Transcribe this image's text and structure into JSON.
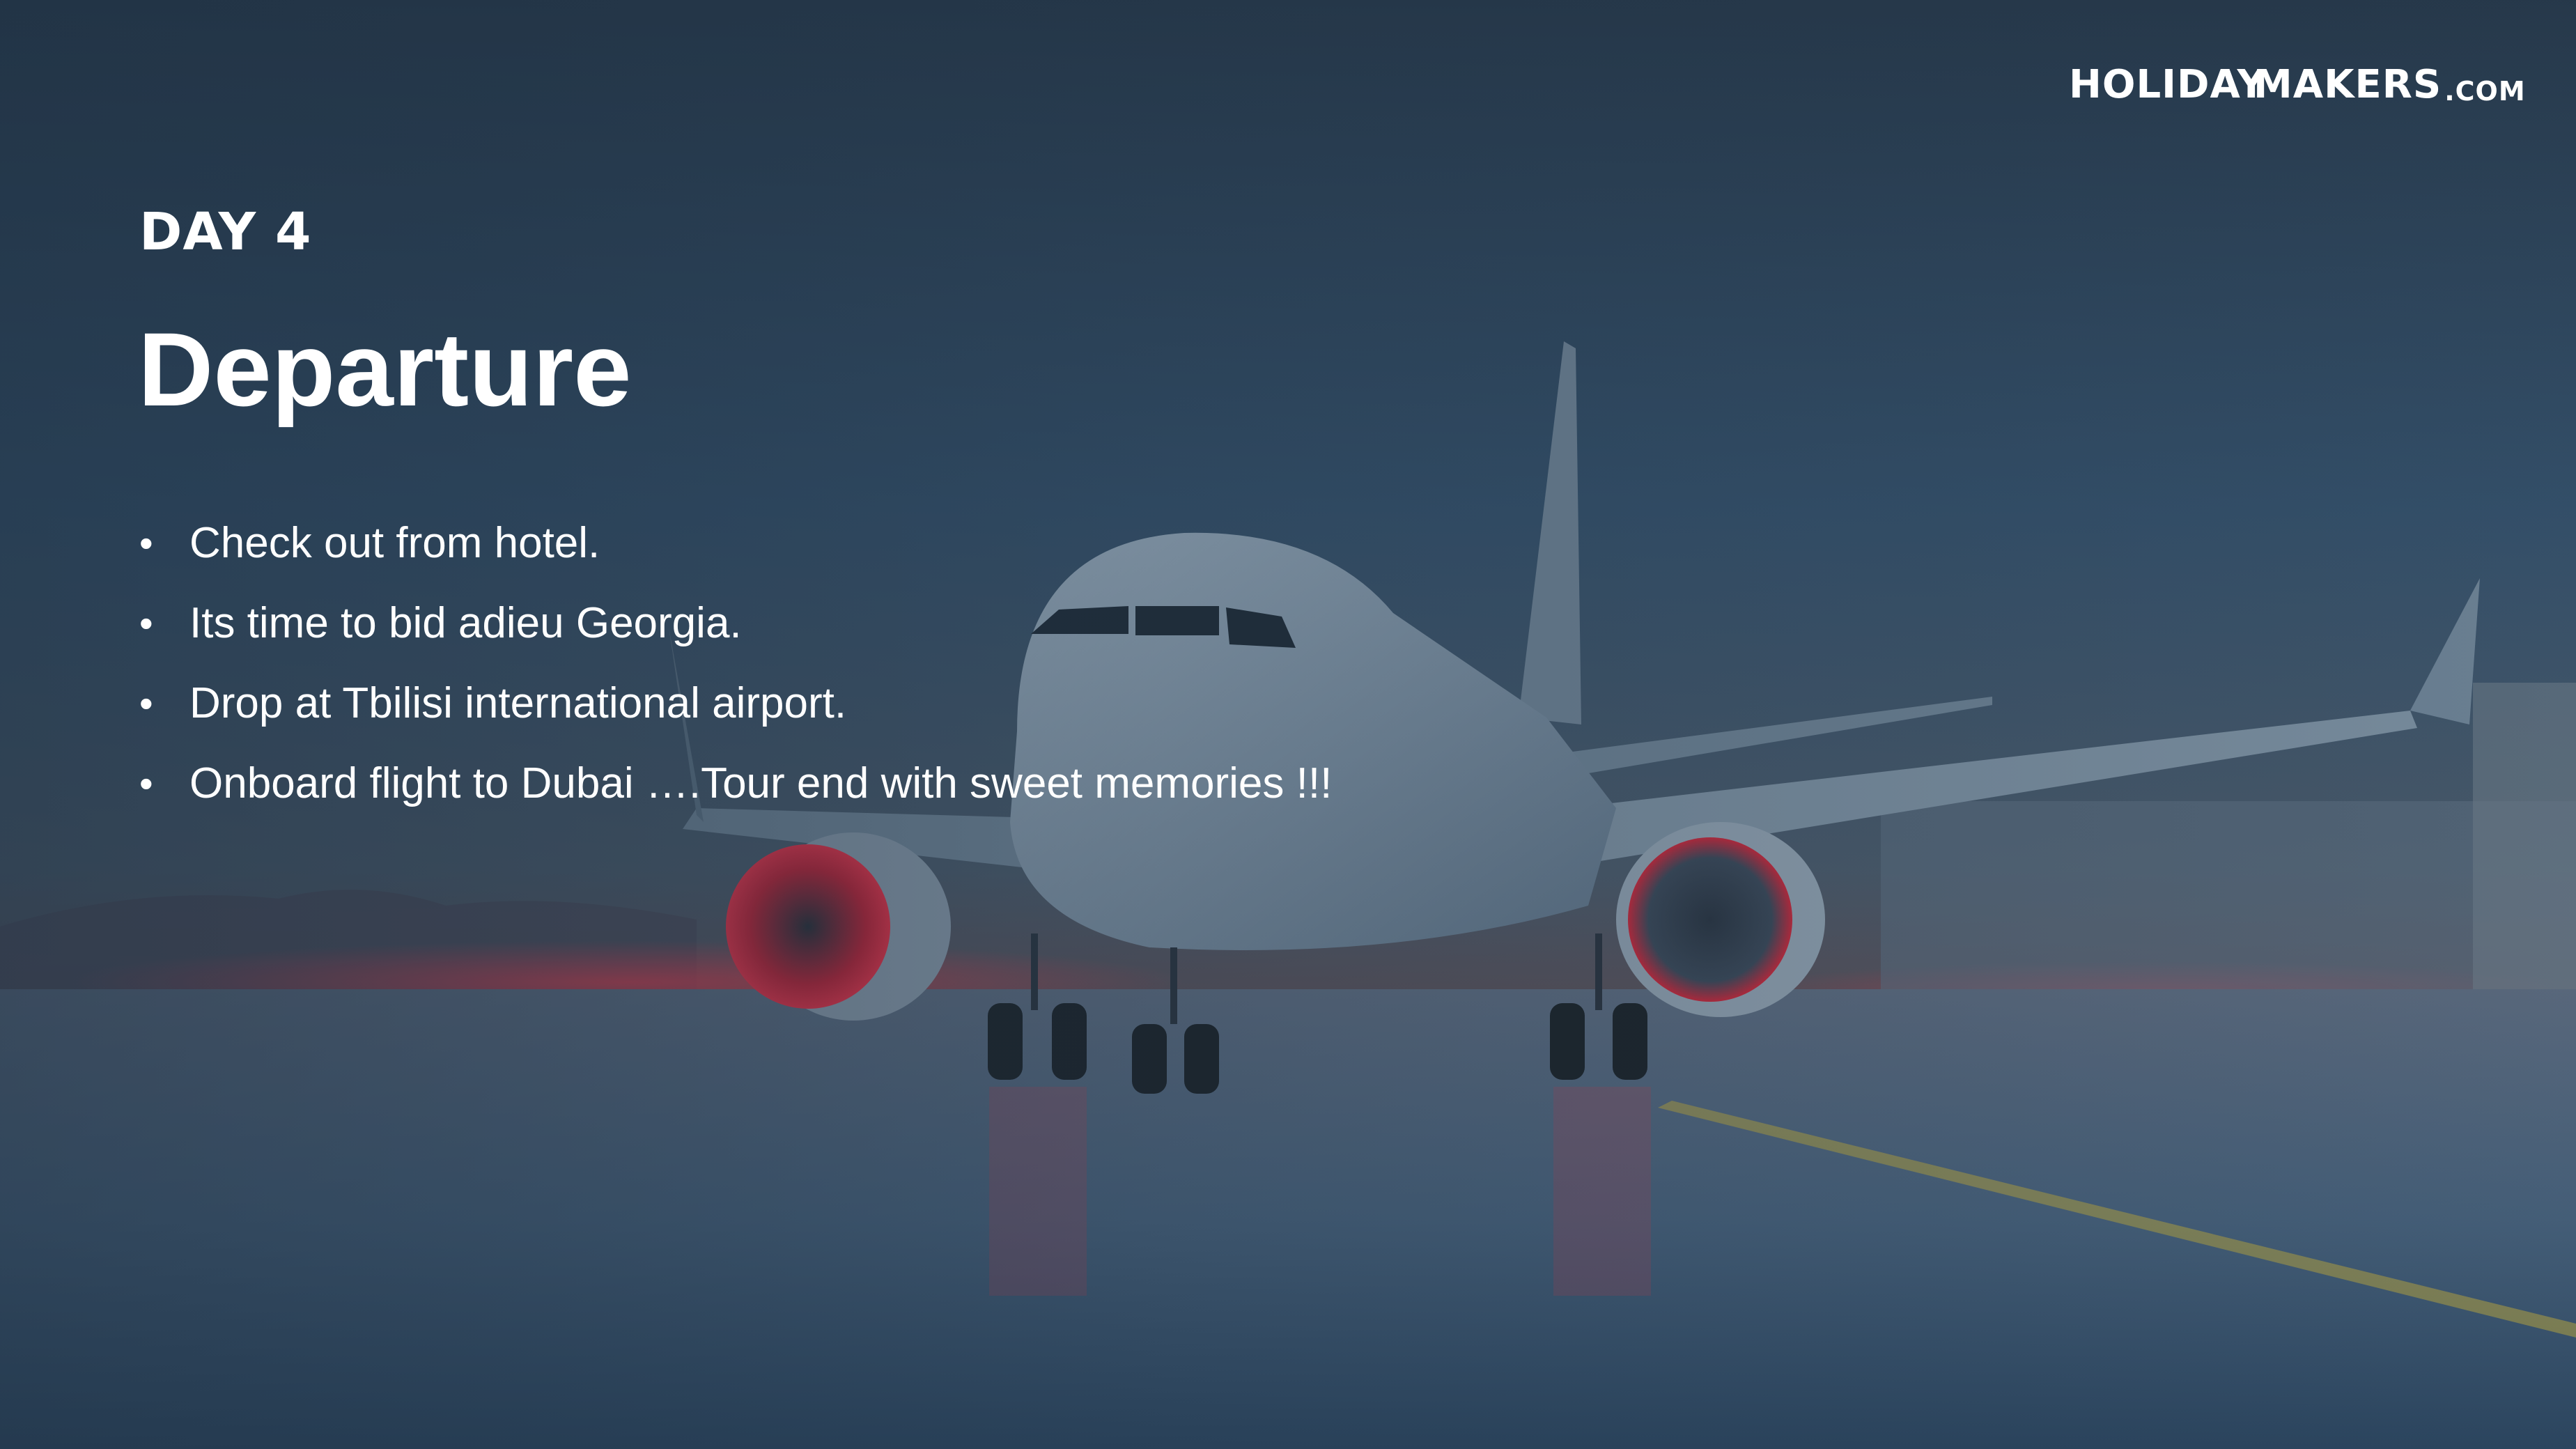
{
  "brand": {
    "logo_text_1": "HOLIDAY",
    "logo_text_2": "MAKERS",
    "logo_text_3": ".COM"
  },
  "slide": {
    "day_label": "DAY 4",
    "title": "Departure",
    "bullets": [
      "Check out from hotel.",
      "Its time to bid adieu Georgia.",
      "Drop at Tbilisi international airport.",
      "Onboard flight to Dubai ….Tour end with sweet memories !!!"
    ]
  },
  "icons": {
    "bullet": "bullet-dot-icon",
    "logo_mark": "palm-tree-icon"
  },
  "colors": {
    "text": "#ffffff",
    "background": "#2c4050",
    "engine_glow": "#d9263a"
  }
}
